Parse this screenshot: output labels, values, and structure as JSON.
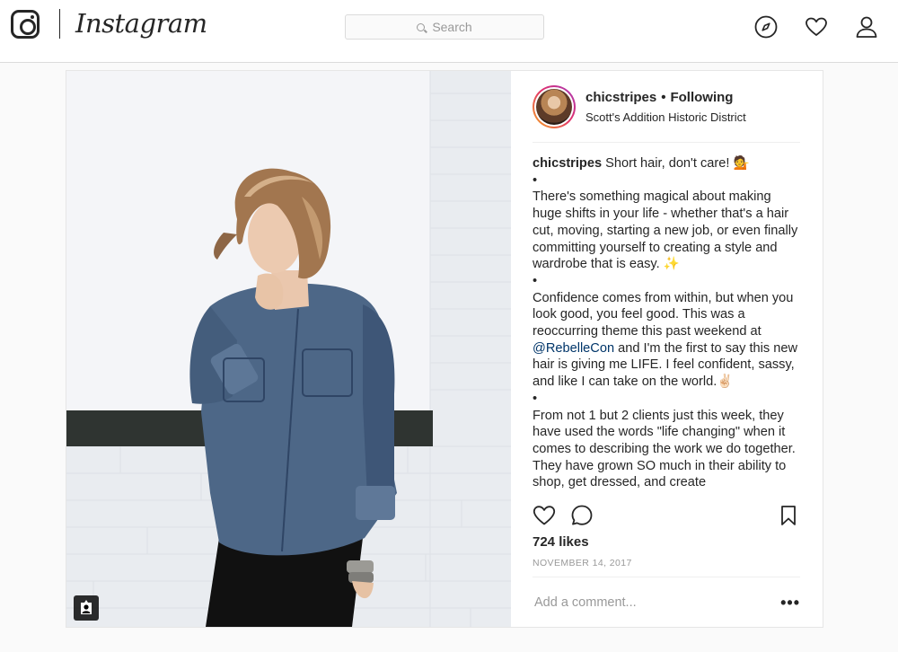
{
  "topbar": {
    "brand": "Instagram",
    "search_placeholder": "Search"
  },
  "post": {
    "username": "chicstripes",
    "follow_status": "Following",
    "location": "Scott's Addition Historic District",
    "caption_lead": "Short hair, don't care! 💁",
    "caption_dot": "•",
    "para1": "There's something magical about making huge shifts in your life - whether that's a hair cut, moving, starting a new job, or even finally committing yourself to creating a style and wardrobe that is easy. ✨",
    "para2_a": "Confidence comes from within, but when you look good, you feel good. This was a reoccurring theme this past weekend at ",
    "mention": "@RebelleCon",
    "para2_b": " and I'm the first to say this new hair is giving me LIFE. I feel confident, sassy, and like I can take on the world.✌🏻",
    "para3": "From not 1 but 2 clients just this week, they have used the words \"life changing\" when it comes to describing the work we do together. They have grown SO much in their ability to shop, get dressed, and create",
    "likes": "724 likes",
    "date": "NOVEMBER 14, 2017",
    "comment_placeholder": "Add a comment...",
    "more_label": "•••"
  },
  "icons": {
    "logo": "instagram-camera-icon",
    "search": "search-icon",
    "explore": "compass-icon",
    "activity": "heart-icon",
    "profile": "person-icon",
    "like": "heart-outline-icon",
    "comment": "comment-icon",
    "save": "bookmark-icon",
    "usertag": "user-tag-icon"
  },
  "colors": {
    "text": "#262626",
    "muted": "#999999",
    "link": "#003569",
    "border": "#dbdbdb",
    "background": "#fafafa"
  }
}
